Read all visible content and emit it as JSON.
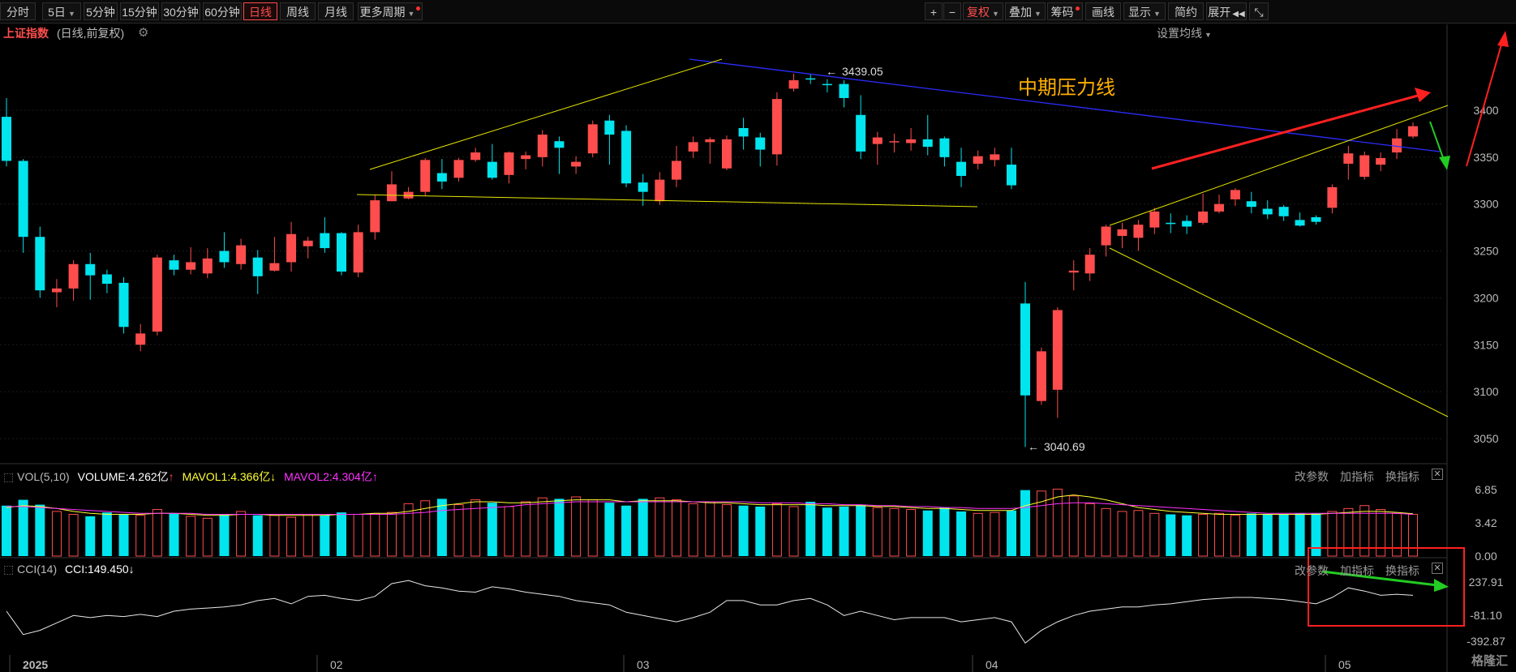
{
  "toolbar": {
    "periods": [
      "分时",
      "5日",
      "5分钟",
      "15分钟",
      "30分钟",
      "60分钟",
      "日线",
      "周线",
      "月线",
      "更多周期"
    ],
    "active_period": "日线",
    "plus": "+",
    "minus": "−",
    "fuquan": "复权",
    "diejia": "叠加",
    "chouma": "筹码",
    "huaxian": "画线",
    "xianshi": "显示",
    "jianyue": "简约",
    "zhankai": "展开",
    "prev_icon": "◀◀",
    "fullscreen_icon": "⤡"
  },
  "header": {
    "title": "上证指数",
    "subtitle": "(日线,前复权)",
    "set_ma": "设置均线"
  },
  "colors": {
    "up": "#ff4d4d",
    "down": "#00e5ee",
    "ma1": "#ffff33",
    "ma2": "#ff33ff",
    "annotation": "#ffb000"
  },
  "annotations": {
    "pressure_line_label": "中期压力线",
    "high_label": "3439.05",
    "low_label": "3040.69"
  },
  "vol_panel": {
    "name": "VOL(5,10)",
    "volume": "VOLUME:4.262亿",
    "mavol1": "MAVOL1:4.366亿",
    "mavol2": "MAVOL2:4.304亿",
    "ticks": [
      "6.85",
      "3.42",
      "0.00"
    ],
    "btn_params": "改参数",
    "btn_add": "加指标",
    "btn_swap": "换指标"
  },
  "cci_panel": {
    "name": "CCI(14)",
    "value": "CCI:149.450",
    "ticks": [
      "237.91",
      "-81.10",
      "-392.87"
    ],
    "btn_params": "改参数",
    "btn_add": "加指标",
    "btn_swap": "换指标"
  },
  "watermark": "格隆汇",
  "chart_data": {
    "type": "candlestick",
    "y_ticks": [
      3400,
      3350,
      3300,
      3250,
      3200,
      3150,
      3100,
      3050
    ],
    "ylim": [
      3035,
      3480
    ],
    "x_labels": [
      "2025",
      "02",
      "03",
      "04",
      "05"
    ],
    "candles": [
      [
        3393,
        3346,
        3413,
        3340
      ],
      [
        3346,
        3265,
        3348,
        3248
      ],
      [
        3265,
        3208,
        3276,
        3200
      ],
      [
        3206,
        3210,
        3220,
        3190
      ],
      [
        3210,
        3236,
        3240,
        3197
      ],
      [
        3236,
        3224,
        3248,
        3198
      ],
      [
        3225,
        3215,
        3230,
        3205
      ],
      [
        3216,
        3169,
        3222,
        3162
      ],
      [
        3150,
        3162,
        3172,
        3143
      ],
      [
        3164,
        3243,
        3246,
        3160
      ],
      [
        3240,
        3230,
        3246,
        3224
      ],
      [
        3230,
        3238,
        3254,
        3225
      ],
      [
        3226,
        3242,
        3253,
        3221
      ],
      [
        3250,
        3238,
        3270,
        3232
      ],
      [
        3236,
        3256,
        3263,
        3230
      ],
      [
        3243,
        3223,
        3251,
        3204
      ],
      [
        3229,
        3237,
        3265,
        3228
      ],
      [
        3238,
        3268,
        3281,
        3228
      ],
      [
        3255,
        3261,
        3265,
        3242
      ],
      [
        3269,
        3253,
        3286,
        3248
      ],
      [
        3269,
        3228,
        3270,
        3224
      ],
      [
        3227,
        3270,
        3278,
        3222
      ],
      [
        3270,
        3304,
        3310,
        3262
      ],
      [
        3303,
        3321,
        3335,
        3303
      ],
      [
        3306,
        3313,
        3318,
        3305
      ],
      [
        3313,
        3347,
        3349,
        3309
      ],
      [
        3333,
        3324,
        3348,
        3316
      ],
      [
        3328,
        3347,
        3349,
        3324
      ],
      [
        3347,
        3355,
        3360,
        3345
      ],
      [
        3345,
        3328,
        3364,
        3326
      ],
      [
        3331,
        3355,
        3356,
        3322
      ],
      [
        3348,
        3352,
        3356,
        3337
      ],
      [
        3350,
        3374,
        3379,
        3340
      ],
      [
        3367,
        3360,
        3372,
        3332
      ],
      [
        3340,
        3345,
        3351,
        3332
      ],
      [
        3354,
        3385,
        3389,
        3350
      ],
      [
        3389,
        3374,
        3395,
        3342
      ],
      [
        3378,
        3322,
        3384,
        3318
      ],
      [
        3323,
        3313,
        3332,
        3298
      ],
      [
        3303,
        3326,
        3334,
        3299
      ],
      [
        3326,
        3346,
        3362,
        3318
      ],
      [
        3356,
        3366,
        3372,
        3349
      ],
      [
        3366,
        3369,
        3371,
        3343
      ],
      [
        3338,
        3369,
        3373,
        3336
      ],
      [
        3381,
        3372,
        3392,
        3358
      ],
      [
        3371,
        3358,
        3376,
        3340
      ],
      [
        3353,
        3412,
        3419,
        3341
      ],
      [
        3423,
        3432,
        3439,
        3420
      ],
      [
        3434,
        3433,
        3439,
        3428
      ],
      [
        3428,
        3427,
        3433,
        3419
      ],
      [
        3428,
        3413,
        3432,
        3403
      ],
      [
        3395,
        3356,
        3416,
        3348
      ],
      [
        3364,
        3371,
        3377,
        3342
      ],
      [
        3366,
        3367,
        3375,
        3355
      ],
      [
        3365,
        3369,
        3381,
        3357
      ],
      [
        3369,
        3361,
        3395,
        3352
      ],
      [
        3370,
        3350,
        3372,
        3340
      ],
      [
        3345,
        3330,
        3360,
        3318
      ],
      [
        3343,
        3351,
        3357,
        3337
      ],
      [
        3347,
        3353,
        3360,
        3340
      ],
      [
        3342,
        3320,
        3360,
        3316
      ],
      [
        3194,
        3096,
        3217,
        3041
      ],
      [
        3090,
        3143,
        3147,
        3086
      ],
      [
        3102,
        3187,
        3190,
        3072
      ],
      [
        3227,
        3229,
        3240,
        3208
      ],
      [
        3226,
        3246,
        3253,
        3218
      ],
      [
        3256,
        3276,
        3278,
        3244
      ],
      [
        3266,
        3273,
        3280,
        3253
      ],
      [
        3264,
        3278,
        3283,
        3250
      ],
      [
        3275,
        3292,
        3296,
        3268
      ],
      [
        3280,
        3279,
        3290,
        3269
      ],
      [
        3282,
        3276,
        3288,
        3268
      ],
      [
        3280,
        3292,
        3311,
        3278
      ],
      [
        3292,
        3300,
        3310,
        3290
      ],
      [
        3305,
        3315,
        3317,
        3298
      ],
      [
        3303,
        3297,
        3313,
        3290
      ],
      [
        3295,
        3289,
        3304,
        3284
      ],
      [
        3297,
        3287,
        3299,
        3282
      ],
      [
        3283,
        3277,
        3291,
        3276
      ],
      [
        3286,
        3281,
        3288,
        3278
      ],
      [
        3296,
        3318,
        3321,
        3290
      ],
      [
        3343,
        3354,
        3362,
        3326
      ],
      [
        3329,
        3352,
        3356,
        3326
      ],
      [
        3342,
        3349,
        3355,
        3335
      ],
      [
        3355,
        3370,
        3380,
        3348
      ],
      [
        3372,
        3383,
        3387,
        3370
      ]
    ],
    "volume": [
      5.2,
      5.8,
      5.3,
      4.6,
      4.3,
      4.1,
      4.5,
      4.3,
      4.2,
      4.8,
      4.4,
      4.1,
      3.9,
      4.3,
      4.6,
      4.2,
      4.2,
      4.0,
      4.3,
      4.2,
      4.5,
      4.3,
      4.4,
      4.5,
      5.4,
      5.7,
      5.9,
      5.3,
      5.8,
      5.5,
      5.1,
      5.6,
      6.0,
      5.9,
      6.1,
      5.8,
      5.5,
      5.2,
      5.9,
      6.0,
      5.8,
      5.4,
      5.6,
      5.3,
      5.2,
      5.1,
      5.4,
      5.1,
      5.6,
      5.0,
      5.1,
      5.3,
      5.0,
      4.9,
      4.8,
      4.7,
      5.0,
      4.6,
      4.4,
      4.5,
      4.7,
      6.8,
      6.7,
      6.9,
      6.2,
      5.4,
      4.9,
      4.6,
      4.7,
      4.4,
      4.3,
      4.2,
      4.3,
      4.4,
      4.2,
      4.4,
      4.3,
      4.3,
      4.4,
      4.4,
      4.6,
      4.9,
      5.2,
      4.8,
      4.4,
      4.3
    ],
    "mavol1": [
      5.0,
      5.2,
      5.1,
      4.9,
      4.6,
      4.4,
      4.3,
      4.3,
      4.3,
      4.4,
      4.4,
      4.3,
      4.2,
      4.2,
      4.3,
      4.3,
      4.2,
      4.2,
      4.2,
      4.2,
      4.3,
      4.3,
      4.4,
      4.4,
      4.6,
      4.9,
      5.2,
      5.4,
      5.6,
      5.6,
      5.5,
      5.5,
      5.6,
      5.7,
      5.8,
      5.8,
      5.8,
      5.6,
      5.7,
      5.7,
      5.7,
      5.6,
      5.5,
      5.5,
      5.4,
      5.3,
      5.3,
      5.3,
      5.3,
      5.2,
      5.2,
      5.2,
      5.1,
      5.1,
      5.0,
      4.9,
      4.9,
      4.8,
      4.7,
      4.7,
      4.7,
      5.2,
      5.6,
      6.1,
      6.3,
      6.1,
      5.8,
      5.4,
      5.0,
      4.8,
      4.6,
      4.5,
      4.4,
      4.3,
      4.3,
      4.3,
      4.3,
      4.3,
      4.3,
      4.3,
      4.4,
      4.5,
      4.6,
      4.6,
      4.5,
      4.37
    ],
    "mavol2": [
      5.1,
      5.1,
      5.0,
      4.9,
      4.8,
      4.7,
      4.6,
      4.5,
      4.4,
      4.4,
      4.4,
      4.4,
      4.3,
      4.3,
      4.3,
      4.3,
      4.3,
      4.3,
      4.3,
      4.3,
      4.3,
      4.3,
      4.3,
      4.3,
      4.4,
      4.5,
      4.7,
      4.8,
      4.9,
      5.0,
      5.1,
      5.3,
      5.4,
      5.5,
      5.6,
      5.6,
      5.6,
      5.6,
      5.6,
      5.6,
      5.6,
      5.6,
      5.6,
      5.6,
      5.6,
      5.5,
      5.5,
      5.5,
      5.4,
      5.4,
      5.3,
      5.3,
      5.2,
      5.2,
      5.1,
      5.1,
      5.0,
      5.0,
      4.9,
      4.9,
      4.9,
      5.0,
      5.2,
      5.4,
      5.5,
      5.5,
      5.4,
      5.3,
      5.2,
      5.1,
      5.0,
      4.9,
      4.8,
      4.7,
      4.6,
      4.5,
      4.4,
      4.4,
      4.4,
      4.4,
      4.4,
      4.4,
      4.4,
      4.4,
      4.4,
      4.3
    ],
    "cci": [
      -20,
      -240,
      -200,
      -130,
      -60,
      -80,
      -60,
      -70,
      -50,
      -70,
      -20,
      0,
      10,
      20,
      40,
      80,
      100,
      50,
      120,
      130,
      100,
      80,
      120,
      240,
      270,
      220,
      200,
      170,
      160,
      210,
      190,
      160,
      140,
      120,
      80,
      60,
      40,
      -30,
      -60,
      -90,
      -120,
      -80,
      -30,
      80,
      80,
      40,
      40,
      80,
      100,
      40,
      -60,
      -20,
      -60,
      -100,
      -80,
      -80,
      -80,
      -120,
      -100,
      -80,
      -120,
      -320,
      -200,
      -120,
      -60,
      -20,
      0,
      20,
      20,
      40,
      50,
      70,
      90,
      100,
      110,
      110,
      100,
      90,
      70,
      50,
      110,
      200,
      170,
      130,
      140,
      130
    ],
    "annotation_lines": [
      {
        "name": "中期压力线",
        "from": [
          0,
          3440
        ],
        "to": [
          85,
          3355
        ]
      }
    ]
  }
}
